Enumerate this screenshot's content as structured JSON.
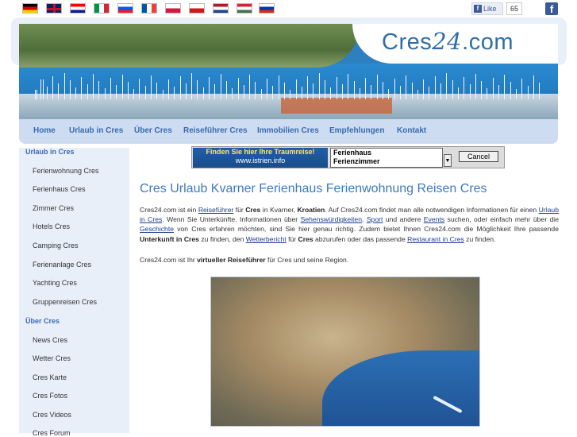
{
  "flags": [
    {
      "name": "flag-germany",
      "colors": [
        "#000000",
        "#dd0000",
        "#ffce00"
      ],
      "dir": "h"
    },
    {
      "name": "flag-uk",
      "colors": [
        "#012169",
        "#ffffff",
        "#c8102e"
      ],
      "dir": "uk"
    },
    {
      "name": "flag-croatia",
      "colors": [
        "#ff0000",
        "#ffffff",
        "#171796"
      ],
      "dir": "h"
    },
    {
      "name": "flag-italy",
      "colors": [
        "#009246",
        "#ffffff",
        "#ce2b37"
      ],
      "dir": "v"
    },
    {
      "name": "flag-slovenia",
      "colors": [
        "#ffffff",
        "#005ce5",
        "#ed1c24"
      ],
      "dir": "h"
    },
    {
      "name": "flag-france",
      "colors": [
        "#0055a4",
        "#ffffff",
        "#ef4135"
      ],
      "dir": "v"
    },
    {
      "name": "flag-poland",
      "colors": [
        "#ffffff",
        "#dc143c"
      ],
      "dir": "h"
    },
    {
      "name": "flag-czech",
      "colors": [
        "#ffffff",
        "#d7141a"
      ],
      "dir": "h"
    },
    {
      "name": "flag-netherlands",
      "colors": [
        "#ae1c28",
        "#ffffff",
        "#21468b"
      ],
      "dir": "h"
    },
    {
      "name": "flag-hungary",
      "colors": [
        "#ce2939",
        "#ffffff",
        "#477050"
      ],
      "dir": "h"
    },
    {
      "name": "flag-russia",
      "colors": [
        "#ffffff",
        "#0039a6",
        "#d52b1e"
      ],
      "dir": "h"
    }
  ],
  "facebook": {
    "like_label": "Like",
    "count": "65",
    "icon": "facebook-icon"
  },
  "logo": {
    "prefix": "Cres",
    "number": "24",
    "suffix": ".com"
  },
  "nav": [
    "Home",
    "Urlaub in Cres",
    "Über Cres",
    "Reiseführer Cres",
    "Immobilien Cres",
    "Empfehlungen",
    "Kontakt"
  ],
  "sidebar": {
    "section1": "Urlaub in Cres",
    "items1": [
      "Ferienwohnung Cres",
      "Ferienhaus Cres",
      "Zimmer Cres",
      "Hotels Cres",
      "Camping Cres",
      "Ferienanlage Cres",
      "Yachting Cres",
      "Gruppenreisen Cres"
    ],
    "section2": "Über Cres",
    "items2": [
      "News Cres",
      "Wetter Cres",
      "Cres Karte",
      "Cres Fotos",
      "Cres Videos",
      "Cres Forum"
    ]
  },
  "ad": {
    "line1": "Finden Sie hier Ihre Traumreise!",
    "line2": "www.istrien.info",
    "options": [
      "Ferienhaus",
      "Ferienzimmer"
    ],
    "cancel": "Cancel"
  },
  "main": {
    "title": "Cres Urlaub Kvarner Ferienhaus Ferienwohnung Reisen Cres",
    "p1": {
      "t1": "Cres24.com ist ein ",
      "a1": "Reiseführer",
      "t2": " für ",
      "b1": "Cres",
      "t3": " in Kvarner, ",
      "b2": "Kroatien",
      "t4": ". Auf Cres24.com findet man alle notwendigen Informationen für einen ",
      "a2": "Urlaub in Cres",
      "t5": ". Wenn Sie Unterkünfte, Informationen über ",
      "a3": "Sehenswürdigkeiten",
      "t6": ", ",
      "a4": "Sport",
      "t7": " und andere ",
      "a5": "Events",
      "t8": " suchen, oder einfach mehr über die ",
      "a6": "Geschichte",
      "t9": " von Cres erfahren möchten, sind Sie hier genau richtig. Zudem bietet Ihnen Cres24.com die Möglichkeit Ihre passende ",
      "b3": "Unterkunft in Cres",
      "t10": " zu finden, den ",
      "a7": "Wetterbericht",
      "t11": " für ",
      "b4": "Cres",
      "t12": " abzurufen oder das passende ",
      "a8": "Restaurant in Cres",
      "t13": " zu finden."
    },
    "p2": {
      "t1": "Cres24.com ist Ihr ",
      "b1": "virtueller Reiseführer",
      "t2": " für Cres und seine Region."
    }
  }
}
